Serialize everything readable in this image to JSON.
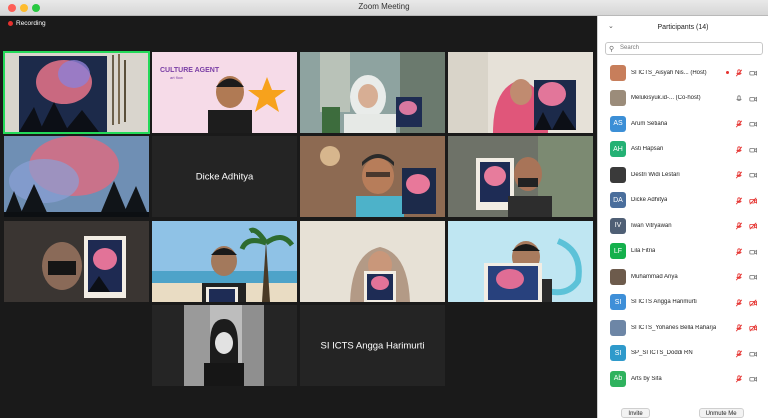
{
  "window": {
    "title": "Zoom Meeting"
  },
  "recording": {
    "label": "Recording"
  },
  "tiles": {
    "t6_name": "Dicke Adhitya",
    "t14_name": "SI ICTS Angga Harimurti",
    "t2_banner": "CULTURE AGENT",
    "t2_sub": "art flow"
  },
  "participants": {
    "header": "Participants (14)",
    "search_placeholder": "Search",
    "items": [
      {
        "name": "SI ICTS_Aisyah Nis... (Host)",
        "initials": "",
        "color": "#c77e5b",
        "photo": true
      },
      {
        "name": "Melukisyuk.id-... (Co-host)",
        "initials": "",
        "color": "#9b8c7a",
        "photo": true
      },
      {
        "name": "Arum Setiana",
        "initials": "AS",
        "color": "#3c8fd6"
      },
      {
        "name": "Asti Hapsari",
        "initials": "AH",
        "color": "#23b174"
      },
      {
        "name": "Destri Widi Lestari",
        "initials": "",
        "color": "#3a3a3a",
        "photo": true
      },
      {
        "name": "Dicke Adhitya",
        "initials": "DA",
        "color": "#4a6e9c"
      },
      {
        "name": "Iwan Vitryawan",
        "initials": "IV",
        "color": "#4f5f75"
      },
      {
        "name": "Lila Fitria",
        "initials": "LF",
        "color": "#14b04c"
      },
      {
        "name": "Muhammad Ariya",
        "initials": "",
        "color": "#6d5b4c",
        "photo": true
      },
      {
        "name": "SI ICTS Angga Harimurti",
        "initials": "SI",
        "color": "#3e8fd8"
      },
      {
        "name": "SI ICTS_Yohanes Bella Raharja",
        "initials": "",
        "color": "#6d86a6",
        "photo": true
      },
      {
        "name": "SP_SI ICTS_Doddi RN",
        "initials": "SI",
        "color": "#2f9acb"
      },
      {
        "name": "Arts by Sifa",
        "initials": "Ab",
        "color": "#2fb25e"
      }
    ],
    "invite_label": "Invite",
    "unmute_label": "Unmute Me"
  },
  "colors": {
    "active_speaker": "#23d959",
    "panel_bg": "#ffffff",
    "meeting_bg": "#1a1a1a"
  }
}
